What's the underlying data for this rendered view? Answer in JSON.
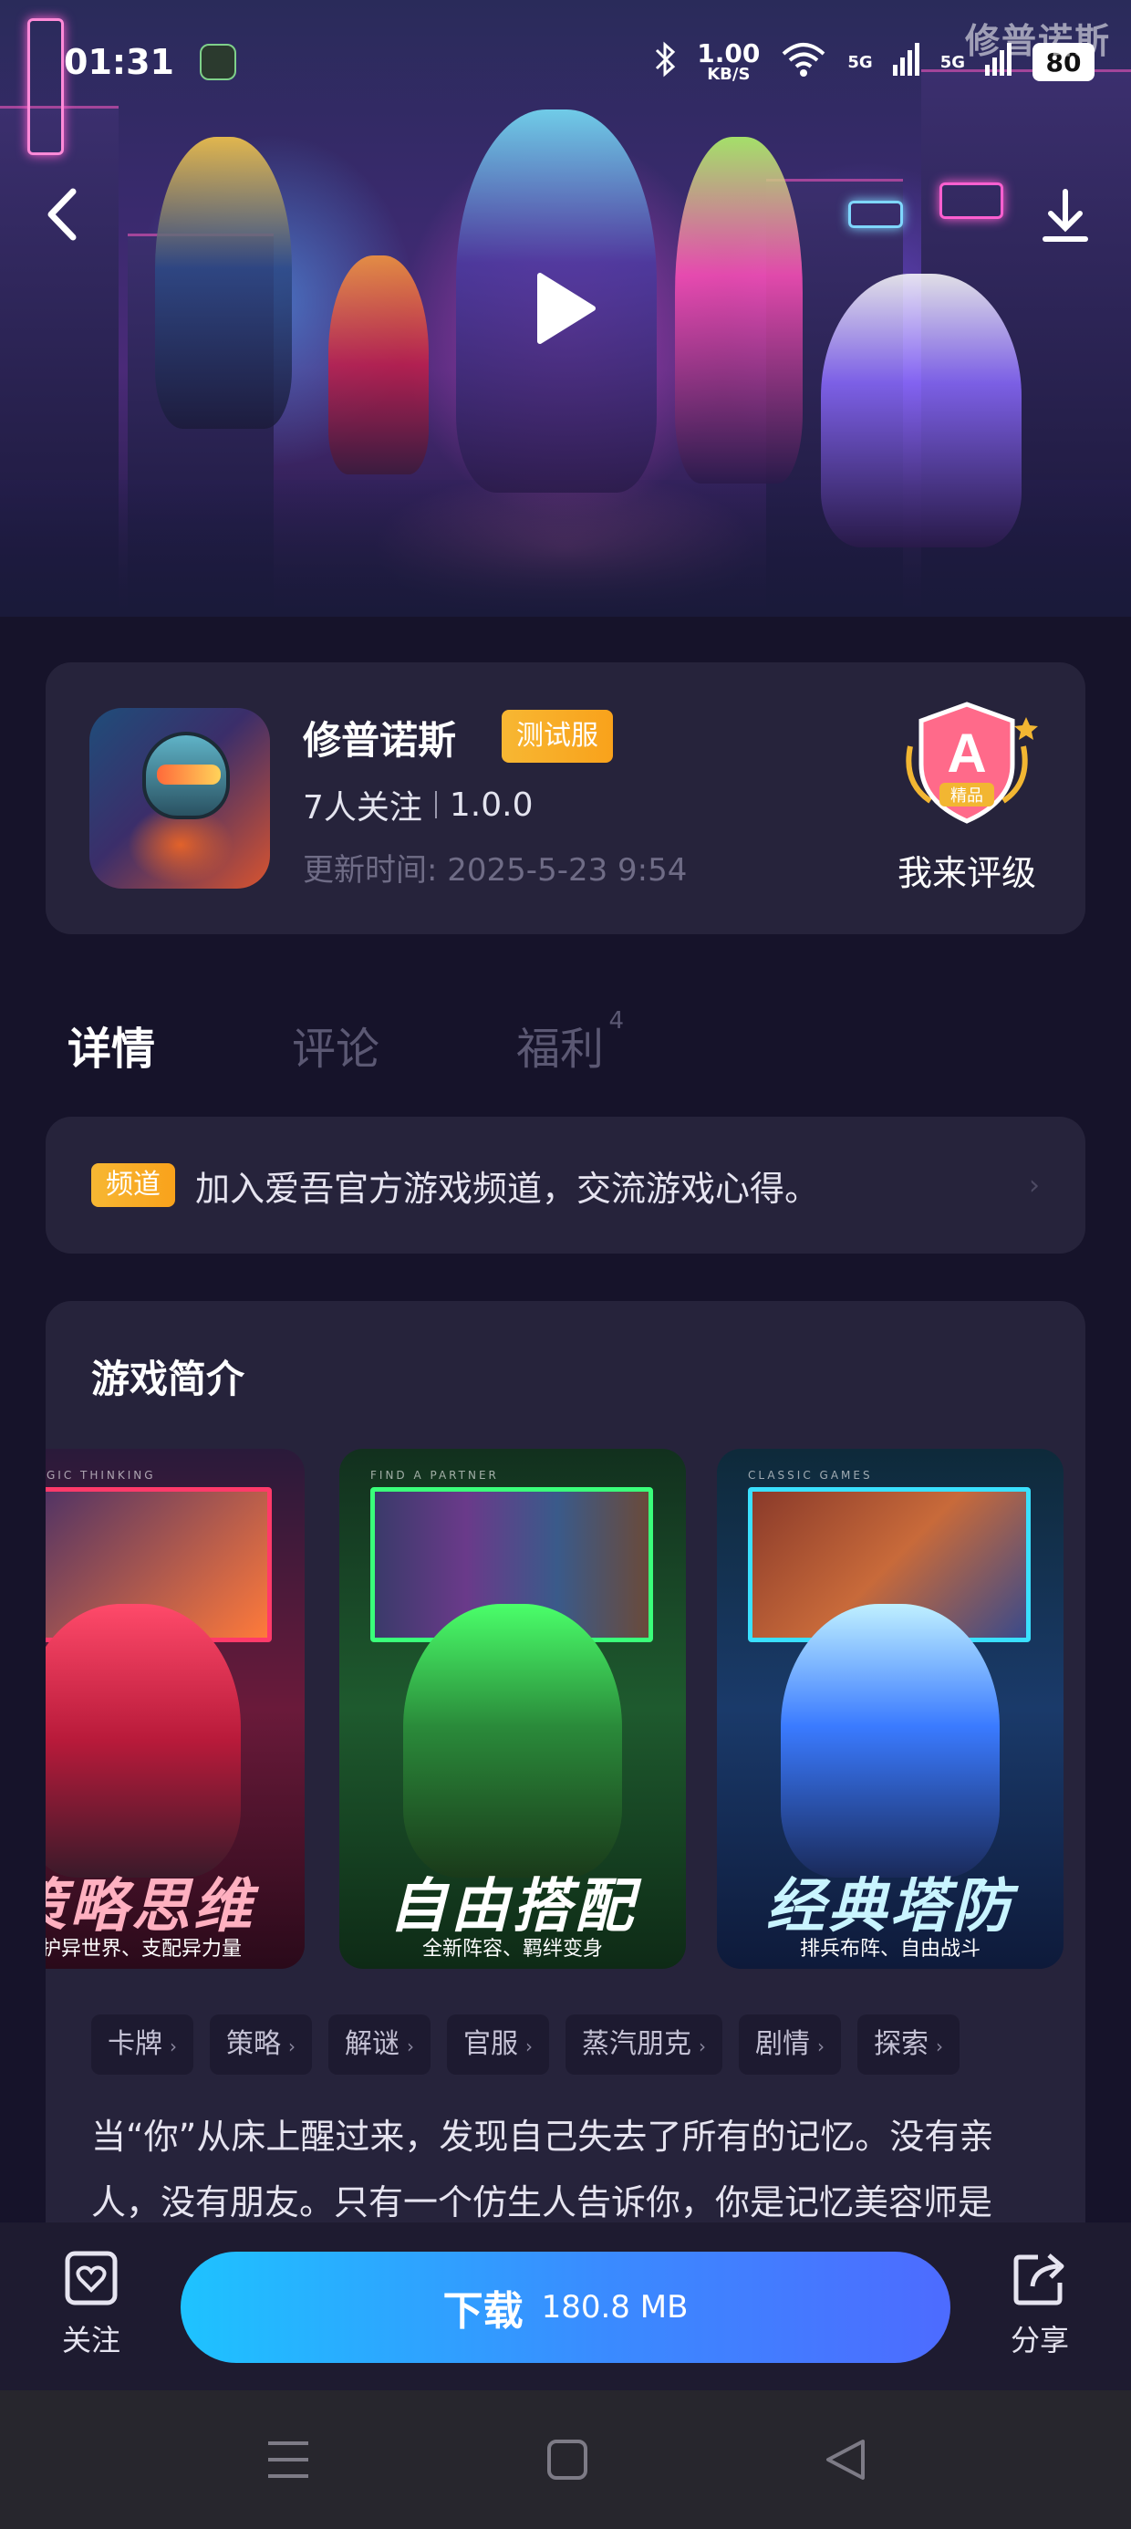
{
  "status_bar": {
    "time": "01:31",
    "net_speed": "1.00",
    "net_unit": "KB/S",
    "signal1": "5G",
    "signal2": "5G",
    "battery": "80"
  },
  "watermark": "修普诺斯",
  "app": {
    "name": "修普诺斯",
    "badge": "测试服",
    "followers": "7人关注",
    "version": "1.0.0",
    "update_label": "更新时间:",
    "update_time": "2025-5-23 9:54",
    "rating_grade": "A",
    "rating_sub": "精品",
    "rating_action": "我来评级"
  },
  "tabs": [
    {
      "label": "详情",
      "active": true
    },
    {
      "label": "评论",
      "active": false
    },
    {
      "label": "福利",
      "badge": "4",
      "active": false
    }
  ],
  "channel": {
    "tag": "频道",
    "text": "加入爱吾官方游戏频道，交流游戏心得。"
  },
  "intro": {
    "title": "游戏简介",
    "screenshots": [
      {
        "caption": "策略思维",
        "sub": "守护异世界、支配异力量",
        "top": "STRATEGIC THINKING"
      },
      {
        "caption": "自由搭配",
        "sub": "全新阵容、羁绊变身",
        "top": "FIND A PARTNER"
      },
      {
        "caption": "经典塔防",
        "sub": "排兵布阵、自由战斗",
        "top": "CLASSIC GAMES"
      }
    ],
    "tags": [
      "卡牌",
      "策略",
      "解谜",
      "官服",
      "蒸汽朋克",
      "剧情",
      "探索"
    ],
    "description_line1": "当“你”从床上醒过来，发现自己失去了所有的记忆。没有亲",
    "description_line2": "人，没有朋友。只有一个仿生人告诉你，你是记忆美容师是"
  },
  "actions": {
    "follow": "关注",
    "download": "下载",
    "download_size": "180.8 MB",
    "share": "分享"
  },
  "colors": {
    "accent_orange": "#f9a21b",
    "download_start": "#1ec3ff",
    "download_end": "#4d6bff",
    "background": "#16132a",
    "card": "#26233b"
  }
}
